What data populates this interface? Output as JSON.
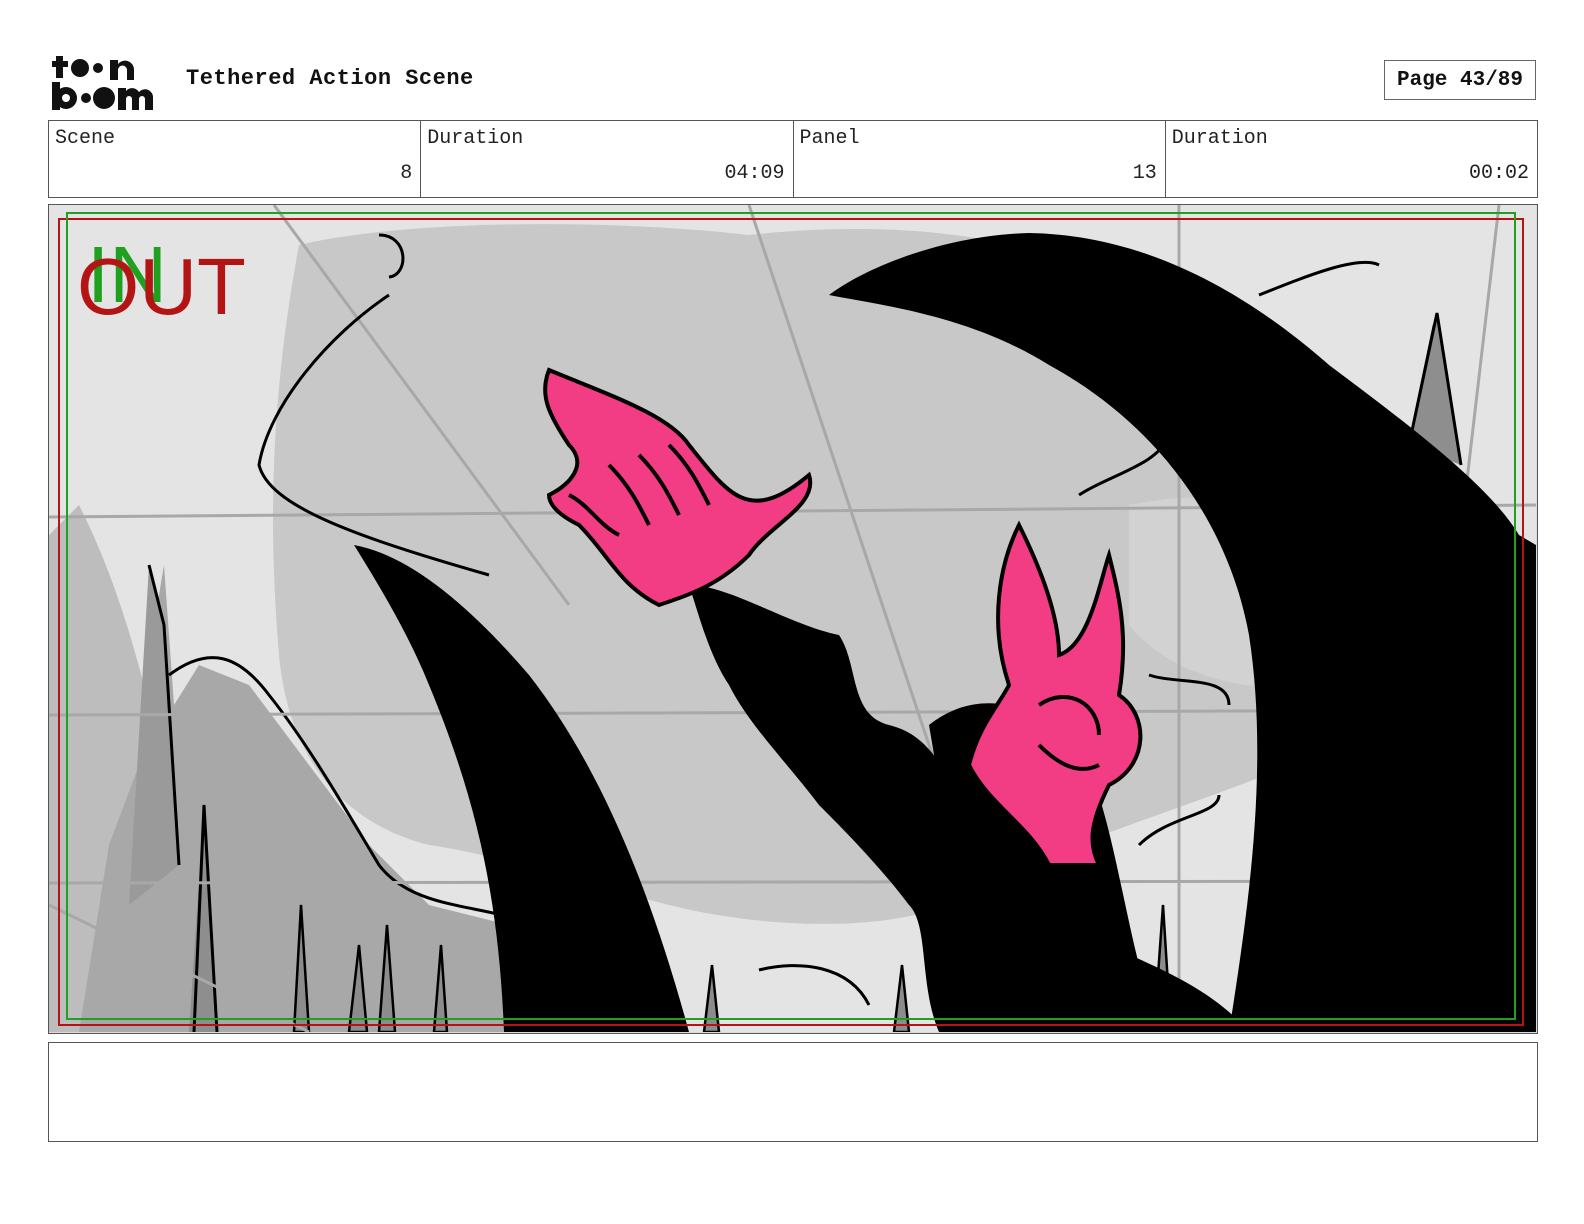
{
  "header": {
    "logo_text": "toon boom",
    "title": "Tethered Action Scene",
    "page_label": "Page 43/89"
  },
  "info": [
    {
      "label": "Scene",
      "value": "8"
    },
    {
      "label": "Duration",
      "value": "04:09"
    },
    {
      "label": "Panel",
      "value": "13"
    },
    {
      "label": "Duration",
      "value": "00:02"
    }
  ],
  "panel": {
    "in_marker": "IN",
    "out_marker": "OUT",
    "colors": {
      "character_pink": "#f23c84",
      "silhouette_black": "#000000",
      "sky_light": "#e6e6e6",
      "mid_gray": "#c4c4c4",
      "in_green": "#1fa01f",
      "out_red": "#b31515"
    }
  },
  "notes": {
    "text": ""
  }
}
